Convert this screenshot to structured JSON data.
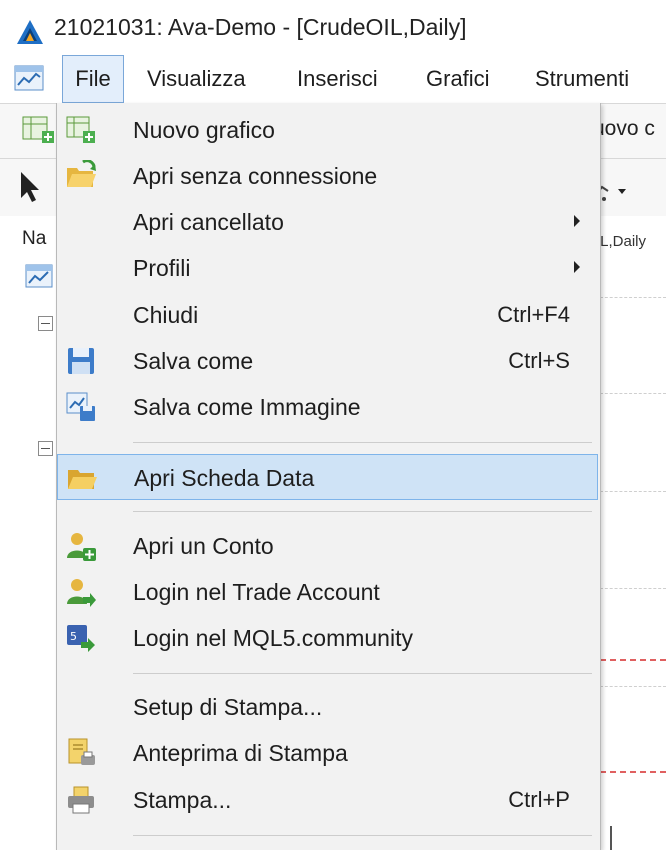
{
  "window": {
    "title": "21021031: Ava-Demo - [CrudeOIL,Daily]"
  },
  "menubar": {
    "items": [
      {
        "label": "File",
        "active": true
      },
      {
        "label": "Visualizza"
      },
      {
        "label": "Inserisci"
      },
      {
        "label": "Grafici"
      },
      {
        "label": "Strumenti"
      }
    ]
  },
  "background": {
    "toolbar_text": "uovo c",
    "navigator_title": "Na",
    "chart_tab": "IL,Daily"
  },
  "file_menu": {
    "items": [
      {
        "label": "Nuovo grafico",
        "icon": "new-chart-icon"
      },
      {
        "label": "Apri senza connessione",
        "icon": "open-offline-icon"
      },
      {
        "label": "Apri cancellato",
        "submenu": true
      },
      {
        "label": "Profili",
        "submenu": true
      },
      {
        "label": "Chiudi",
        "shortcut": "Ctrl+F4"
      },
      {
        "label": "Salva come",
        "shortcut": "Ctrl+S",
        "icon": "save-icon"
      },
      {
        "label": "Salva come Immagine",
        "icon": "save-image-icon"
      },
      {
        "label": "Apri Scheda Data",
        "icon": "folder-icon",
        "selected": true
      },
      {
        "label": "Apri un Conto",
        "icon": "open-account-icon"
      },
      {
        "label": "Login nel Trade Account",
        "icon": "login-trade-icon"
      },
      {
        "label": "Login nel MQL5.community",
        "icon": "mql5-login-icon"
      },
      {
        "label": "Setup di Stampa..."
      },
      {
        "label": "Anteprima di Stampa",
        "icon": "print-preview-icon"
      },
      {
        "label": "Stampa...",
        "shortcut": "Ctrl+P",
        "icon": "printer-icon"
      }
    ]
  },
  "colors": {
    "selection_bg": "#cfe3f6",
    "selection_border": "#7eb4ea",
    "menu_bg": "#f2f2f2",
    "accent_logo": "#1f6fc5"
  }
}
